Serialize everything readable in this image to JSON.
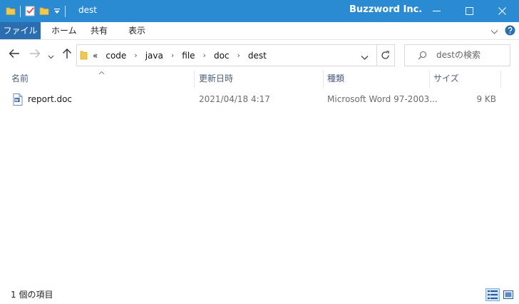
{
  "window": {
    "title": "dest",
    "brand": "Buzzword Inc.",
    "controls": [
      "minimize",
      "maximize",
      "close"
    ],
    "accent_color": "#2b8bd2"
  },
  "ribbon": {
    "tabs": [
      {
        "label": "ファイル",
        "active": true
      },
      {
        "label": "ホーム"
      },
      {
        "label": "共有"
      },
      {
        "label": "表示"
      }
    ]
  },
  "address": {
    "overflow_label": "«",
    "crumbs": [
      "code",
      "java",
      "file",
      "doc",
      "dest"
    ]
  },
  "search": {
    "placeholder": "destの検索"
  },
  "columns": {
    "name": "名前",
    "modified": "更新日時",
    "type": "種類",
    "size": "サイズ"
  },
  "files": [
    {
      "name": "report.doc",
      "modified": "2021/04/18 4:17",
      "type": "Microsoft Word 97-2003...",
      "size": "9 KB",
      "icon": "word-document-icon"
    }
  ],
  "status": {
    "item_count": "1 個の項目",
    "view_mode": "details"
  }
}
